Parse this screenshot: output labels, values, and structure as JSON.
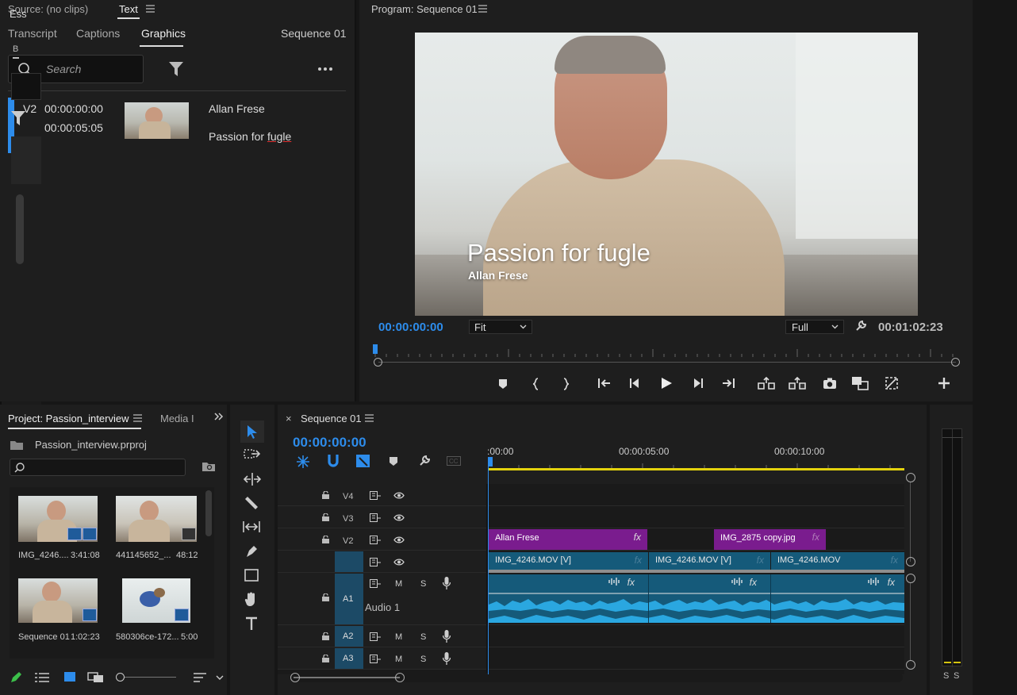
{
  "text_panel": {
    "source_label": "Source: (no clips)",
    "panel_tab": "Text",
    "tabs": [
      "Transcript",
      "Captions",
      "Graphics"
    ],
    "active_tab": "Graphics",
    "sequence_label": "Sequence 01",
    "search_placeholder": "Search",
    "graphic_item": {
      "track": "V2",
      "time_in": "00:00:00:00",
      "time_out": "00:00:05:05",
      "line1": "Allan Frese",
      "line2_prefix": "Passion for ",
      "line2_underlined": "fugle"
    }
  },
  "program_monitor": {
    "title": "Program: Sequence 01",
    "overlay_title": "Passion for fugle",
    "overlay_name": "Allan Frese",
    "timecode_current": "00:00:00:00",
    "fit_select": "Fit",
    "quality_select": "Full",
    "timecode_duration": "00:01:02:23",
    "accent": "#2d8ceb"
  },
  "project_panel": {
    "title": "Project: Passion_interview",
    "media_tab": "Media I",
    "project_file": "Passion_interview.prproj",
    "items": [
      {
        "name": "IMG_4246....",
        "duration": "3:41:08"
      },
      {
        "name": "441145652_...",
        "duration": "48:12"
      },
      {
        "name": "Sequence 01",
        "duration": "1:02:23"
      },
      {
        "name": "580306ce-172...",
        "duration": "5:00"
      }
    ]
  },
  "timeline": {
    "title": "Sequence 01",
    "timecode": "00:00:00:00",
    "ruler": [
      "00:00",
      "00:00:05:00",
      "00:00:10:00"
    ],
    "ruler_first_prefix": ":",
    "tracks": {
      "v4": "V4",
      "v3": "V3",
      "v2": "V2",
      "a1": "A1",
      "a2": "A2",
      "a3": "A3",
      "audio1_name": "Audio 1",
      "m": "M",
      "s": "S"
    },
    "clips": {
      "graphic1": "Allan Frese",
      "graphic2": "IMG_2875 copy.jpg",
      "video1": "IMG_4246.MOV [V]",
      "video2": "IMG_4246.MOV [V]",
      "video3": "IMG_4246.MOV",
      "fx": "fx"
    }
  },
  "meter": {
    "solo_left": "S",
    "solo_right": "S"
  },
  "essentials": {
    "label": "Ess",
    "sub": "B"
  }
}
